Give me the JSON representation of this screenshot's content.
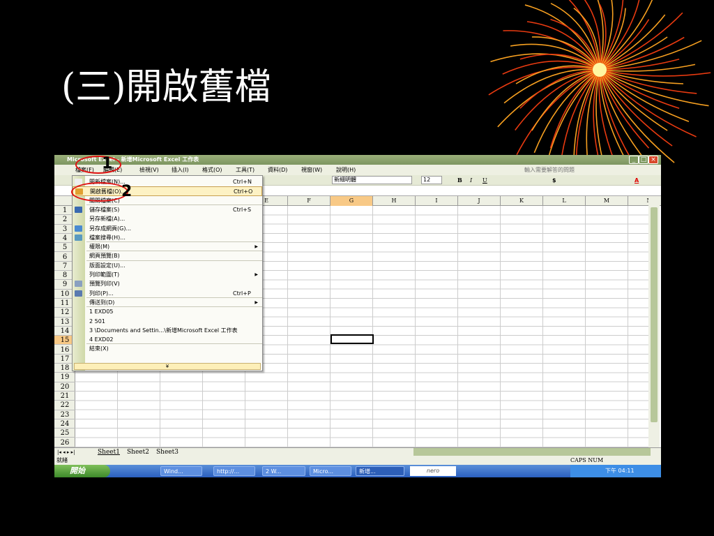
{
  "slide": {
    "title": "(三)開啟舊檔"
  },
  "excel": {
    "window_title": "Microsoft Excel - 新增Microsoft Excel 工作表",
    "menus": [
      "檔案(F)",
      "編輯(E)",
      "檢視(V)",
      "插入(I)",
      "格式(O)",
      "工具(T)",
      "資料(D)",
      "視窗(W)",
      "說明(H)"
    ],
    "help_box": "輸入需要解答的問題",
    "font_name": "新細明體",
    "font_size": "12",
    "columns": [
      "E",
      "F",
      "G",
      "H",
      "I",
      "J",
      "K",
      "L",
      "M",
      "N"
    ],
    "selected_column": "G",
    "rows": [
      "1",
      "2",
      "3",
      "4",
      "5",
      "6",
      "7",
      "8",
      "9",
      "10",
      "11",
      "12",
      "13",
      "14",
      "15",
      "16",
      "17",
      "18",
      "19",
      "20",
      "21",
      "22",
      "23",
      "24",
      "25",
      "26"
    ],
    "selected_row": "15",
    "sheets": [
      "Sheet1",
      "Sheet2",
      "Sheet3"
    ],
    "status_left": "就緒",
    "status_right": "CAPS NUM"
  },
  "file_menu": {
    "items": [
      {
        "label": "開新檔案(N)...",
        "shortcut": "Ctrl+N"
      },
      {
        "label": "開啟舊檔(O)...",
        "shortcut": "Ctrl+O"
      },
      {
        "label": "關閉檔案(C)",
        "shortcut": ""
      },
      {
        "label": "儲存檔案(S)",
        "shortcut": "Ctrl+S"
      },
      {
        "label": "另存新檔(A)...",
        "shortcut": ""
      },
      {
        "label": "另存成網頁(G)...",
        "shortcut": ""
      },
      {
        "label": "檔案搜尋(H)...",
        "shortcut": ""
      },
      {
        "label": "權限(M)",
        "shortcut": ""
      },
      {
        "label": "網頁預覽(B)",
        "shortcut": ""
      },
      {
        "label": "版面設定(U)...",
        "shortcut": ""
      },
      {
        "label": "列印範圍(T)",
        "shortcut": ""
      },
      {
        "label": "預覽列印(V)",
        "shortcut": ""
      },
      {
        "label": "列印(P)...",
        "shortcut": "Ctrl+P"
      },
      {
        "label": "傳送到(D)",
        "shortcut": ""
      },
      {
        "label": "1 EXD05",
        "shortcut": ""
      },
      {
        "label": "2 501",
        "shortcut": ""
      },
      {
        "label": "3 \\Documents and Settin...\\新增Microsoft Excel 工作表",
        "shortcut": ""
      },
      {
        "label": "4 EXD02",
        "shortcut": ""
      },
      {
        "label": "結束(X)",
        "shortcut": ""
      }
    ],
    "expand": "¥"
  },
  "annotations": {
    "step1": "1",
    "step2": "2"
  },
  "taskbar": {
    "start": "開始",
    "buttons": [
      "Wind...",
      "http://...",
      "2 W...",
      "Micro...",
      "新增..."
    ],
    "nero": "nero",
    "clock": "下午 04:11"
  },
  "colors": {
    "accent": "#e01010",
    "titlebar": "#8aa26c",
    "menu_highlight": "#fdf2c4"
  }
}
